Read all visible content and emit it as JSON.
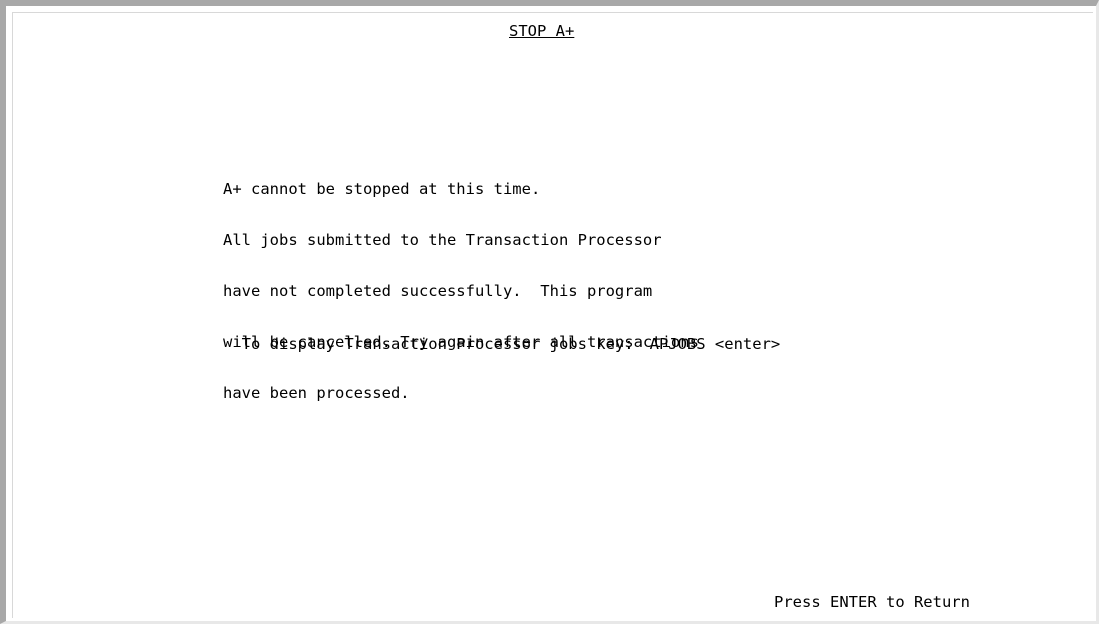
{
  "screen": {
    "title": "STOP A+",
    "message_lines": [
      "A+ cannot be stopped at this time.",
      "All jobs submitted to the Transaction Processor",
      "have not completed successfully.  This program",
      "will be cancelled. Try again after all transactions",
      "have been processed."
    ],
    "hint": {
      "label": "To display Transaction Processor jobs key:",
      "command": "APJOBS <enter>"
    },
    "footer_prompt": "Press ENTER to Return"
  }
}
